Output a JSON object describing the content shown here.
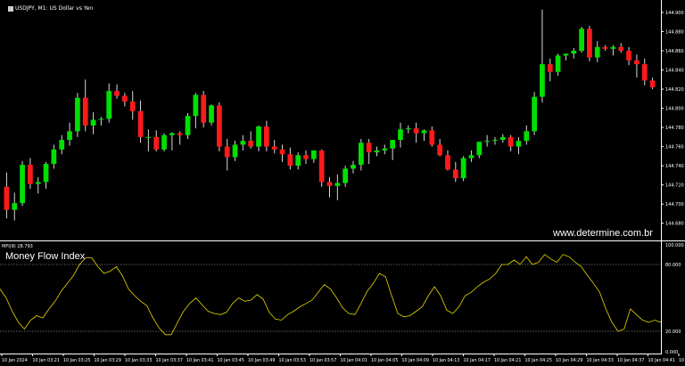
{
  "header": {
    "symbol_label": "USDJPY, M1:  US Dollar vs Yen"
  },
  "indicator": {
    "label": "MFI(9) 28.793",
    "title": "Money Flow Index"
  },
  "watermark": "www.determine.com.br",
  "colors": {
    "background": "#000000",
    "bull": "#00e000",
    "bear": "#ff1a1a",
    "wick": "#d8d8d8",
    "axis": "#ffffff",
    "mfi_line": "#e6d700",
    "level_line": "#bdbdbd"
  },
  "chart_data": [
    {
      "type": "candlestick",
      "title": "USDJPY, M1:  US Dollar vs Yen",
      "ylim": [
        144.663,
        144.913
      ],
      "y_ticks": [
        "144.900",
        "144.880",
        "144.860",
        "144.840",
        "144.820",
        "144.800",
        "144.780",
        "144.760",
        "144.740",
        "144.720",
        "144.700",
        "144.680"
      ],
      "x_tick_labels": [
        "10 Jan 2024",
        "10 Jan 03:21",
        "10 Jan 03:25",
        "10 Jan 03:29",
        "10 Jan 03:33",
        "10 Jan 03:37",
        "10 Jan 03:41",
        "10 Jan 03:45",
        "10 Jan 03:49",
        "10 Jan 03:53",
        "10 Jan 03:57",
        "10 Jan 04:01",
        "10 Jan 04:05",
        "10 Jan 04:09",
        "10 Jan 04:13",
        "10 Jan 04:17",
        "10 Jan 04:21",
        "10 Jan 04:25",
        "10 Jan 04:29",
        "10 Jan 04:33",
        "10 Jan 04:37",
        "10 Jan 04:41",
        "10 Jan 04:45"
      ],
      "candles": [
        {
          "o": 144.718,
          "h": 144.733,
          "l": 144.685,
          "c": 144.694
        },
        {
          "o": 144.694,
          "h": 144.712,
          "l": 144.683,
          "c": 144.701
        },
        {
          "o": 144.701,
          "h": 144.745,
          "l": 144.698,
          "c": 144.741
        },
        {
          "o": 144.741,
          "h": 144.748,
          "l": 144.716,
          "c": 144.721
        },
        {
          "o": 144.721,
          "h": 144.728,
          "l": 144.711,
          "c": 144.723
        },
        {
          "o": 144.723,
          "h": 144.744,
          "l": 144.716,
          "c": 144.742
        },
        {
          "o": 144.742,
          "h": 144.762,
          "l": 144.737,
          "c": 144.757
        },
        {
          "o": 144.757,
          "h": 144.772,
          "l": 144.752,
          "c": 144.767
        },
        {
          "o": 144.767,
          "h": 144.785,
          "l": 144.761,
          "c": 144.776
        },
        {
          "o": 144.776,
          "h": 144.816,
          "l": 144.77,
          "c": 144.811
        },
        {
          "o": 144.811,
          "h": 144.83,
          "l": 144.776,
          "c": 144.782
        },
        {
          "o": 144.782,
          "h": 144.796,
          "l": 144.773,
          "c": 144.788
        },
        {
          "o": 144.788,
          "h": 144.791,
          "l": 144.782,
          "c": 144.789
        },
        {
          "o": 144.789,
          "h": 144.826,
          "l": 144.785,
          "c": 144.818
        },
        {
          "o": 144.818,
          "h": 144.825,
          "l": 144.81,
          "c": 144.813
        },
        {
          "o": 144.813,
          "h": 144.816,
          "l": 144.802,
          "c": 144.807
        },
        {
          "o": 144.807,
          "h": 144.818,
          "l": 144.788,
          "c": 144.797
        },
        {
          "o": 144.797,
          "h": 144.808,
          "l": 144.764,
          "c": 144.77
        },
        {
          "o": 144.77,
          "h": 144.778,
          "l": 144.755,
          "c": 144.77
        },
        {
          "o": 144.77,
          "h": 144.777,
          "l": 144.755,
          "c": 144.757
        },
        {
          "o": 144.757,
          "h": 144.774,
          "l": 144.755,
          "c": 144.772
        },
        {
          "o": 144.772,
          "h": 144.775,
          "l": 144.756,
          "c": 144.774
        },
        {
          "o": 144.774,
          "h": 144.776,
          "l": 144.762,
          "c": 144.772
        },
        {
          "o": 144.772,
          "h": 144.795,
          "l": 144.768,
          "c": 144.792
        },
        {
          "o": 144.792,
          "h": 144.816,
          "l": 144.779,
          "c": 144.814
        },
        {
          "o": 144.814,
          "h": 144.818,
          "l": 144.78,
          "c": 144.785
        },
        {
          "o": 144.785,
          "h": 144.804,
          "l": 144.782,
          "c": 144.803
        },
        {
          "o": 144.803,
          "h": 144.806,
          "l": 144.755,
          "c": 144.76
        },
        {
          "o": 144.76,
          "h": 144.768,
          "l": 144.735,
          "c": 144.749
        },
        {
          "o": 144.749,
          "h": 144.766,
          "l": 144.745,
          "c": 144.762
        },
        {
          "o": 144.762,
          "h": 144.772,
          "l": 144.756,
          "c": 144.766
        },
        {
          "o": 144.766,
          "h": 144.776,
          "l": 144.758,
          "c": 144.76
        },
        {
          "o": 144.76,
          "h": 144.782,
          "l": 144.755,
          "c": 144.781
        },
        {
          "o": 144.781,
          "h": 144.787,
          "l": 144.755,
          "c": 144.76
        },
        {
          "o": 144.76,
          "h": 144.767,
          "l": 144.753,
          "c": 144.757
        },
        {
          "o": 144.757,
          "h": 144.762,
          "l": 144.744,
          "c": 144.752
        },
        {
          "o": 144.752,
          "h": 144.759,
          "l": 144.736,
          "c": 144.74
        },
        {
          "o": 144.74,
          "h": 144.754,
          "l": 144.736,
          "c": 144.751
        },
        {
          "o": 144.751,
          "h": 144.756,
          "l": 144.742,
          "c": 144.747
        },
        {
          "o": 144.747,
          "h": 144.755,
          "l": 144.743,
          "c": 144.756
        },
        {
          "o": 144.756,
          "h": 144.757,
          "l": 144.718,
          "c": 144.723
        },
        {
          "o": 144.723,
          "h": 144.728,
          "l": 144.707,
          "c": 144.719
        },
        {
          "o": 144.719,
          "h": 144.731,
          "l": 144.704,
          "c": 144.722
        },
        {
          "o": 144.722,
          "h": 144.74,
          "l": 144.718,
          "c": 144.737
        },
        {
          "o": 144.737,
          "h": 144.745,
          "l": 144.732,
          "c": 144.741
        },
        {
          "o": 144.741,
          "h": 144.768,
          "l": 144.735,
          "c": 144.764
        },
        {
          "o": 144.764,
          "h": 144.768,
          "l": 144.742,
          "c": 144.754
        },
        {
          "o": 144.754,
          "h": 144.76,
          "l": 144.75,
          "c": 144.756
        },
        {
          "o": 144.756,
          "h": 144.762,
          "l": 144.752,
          "c": 144.758
        },
        {
          "o": 144.758,
          "h": 144.767,
          "l": 144.746,
          "c": 144.767
        },
        {
          "o": 144.767,
          "h": 144.785,
          "l": 144.759,
          "c": 144.778
        },
        {
          "o": 144.778,
          "h": 144.782,
          "l": 144.774,
          "c": 144.779
        },
        {
          "o": 144.779,
          "h": 144.785,
          "l": 144.764,
          "c": 144.774
        },
        {
          "o": 144.774,
          "h": 144.778,
          "l": 144.766,
          "c": 144.777
        },
        {
          "o": 144.777,
          "h": 144.781,
          "l": 144.76,
          "c": 144.762
        },
        {
          "o": 144.762,
          "h": 144.768,
          "l": 144.75,
          "c": 144.751
        },
        {
          "o": 144.751,
          "h": 144.756,
          "l": 144.735,
          "c": 144.736
        },
        {
          "o": 144.736,
          "h": 144.744,
          "l": 144.723,
          "c": 144.727
        },
        {
          "o": 144.727,
          "h": 144.75,
          "l": 144.724,
          "c": 144.748
        },
        {
          "o": 144.748,
          "h": 144.756,
          "l": 144.744,
          "c": 144.751
        },
        {
          "o": 144.751,
          "h": 144.761,
          "l": 144.748,
          "c": 144.765
        },
        {
          "o": 144.765,
          "h": 144.772,
          "l": 144.76,
          "c": 144.766
        },
        {
          "o": 144.766,
          "h": 144.77,
          "l": 144.762,
          "c": 144.767
        },
        {
          "o": 144.767,
          "h": 144.773,
          "l": 144.764,
          "c": 144.77
        },
        {
          "o": 144.77,
          "h": 144.772,
          "l": 144.755,
          "c": 144.76
        },
        {
          "o": 144.76,
          "h": 144.77,
          "l": 144.752,
          "c": 144.766
        },
        {
          "o": 144.766,
          "h": 144.782,
          "l": 144.762,
          "c": 144.776
        },
        {
          "o": 144.776,
          "h": 144.817,
          "l": 144.772,
          "c": 144.812
        },
        {
          "o": 144.812,
          "h": 144.903,
          "l": 144.806,
          "c": 144.846
        },
        {
          "o": 144.846,
          "h": 144.852,
          "l": 144.828,
          "c": 144.838
        },
        {
          "o": 144.838,
          "h": 144.857,
          "l": 144.834,
          "c": 144.855
        },
        {
          "o": 144.855,
          "h": 144.857,
          "l": 144.85,
          "c": 144.857
        },
        {
          "o": 144.857,
          "h": 144.863,
          "l": 144.852,
          "c": 144.86
        },
        {
          "o": 144.86,
          "h": 144.885,
          "l": 144.858,
          "c": 144.883
        },
        {
          "o": 144.883,
          "h": 144.886,
          "l": 144.849,
          "c": 144.853
        },
        {
          "o": 144.853,
          "h": 144.87,
          "l": 144.848,
          "c": 144.864
        },
        {
          "o": 144.864,
          "h": 144.866,
          "l": 144.86,
          "c": 144.862
        },
        {
          "o": 144.862,
          "h": 144.866,
          "l": 144.855,
          "c": 144.864
        },
        {
          "o": 144.864,
          "h": 144.868,
          "l": 144.858,
          "c": 144.86
        },
        {
          "o": 144.86,
          "h": 144.864,
          "l": 144.845,
          "c": 144.85
        },
        {
          "o": 144.85,
          "h": 144.856,
          "l": 144.832,
          "c": 144.846
        },
        {
          "o": 144.846,
          "h": 144.852,
          "l": 144.824,
          "c": 144.829
        },
        {
          "o": 144.829,
          "h": 144.832,
          "l": 144.82,
          "c": 144.822
        }
      ]
    },
    {
      "type": "line",
      "title": "Money Flow Index",
      "ylim": [
        0,
        100
      ],
      "y_ticks": [
        "100.000",
        "80.000",
        "20.000",
        "0.000"
      ],
      "levels": [
        80,
        20
      ],
      "series": [
        {
          "name": "MFI(9)",
          "values": [
            58,
            50,
            38,
            28,
            22,
            30,
            34,
            32,
            40,
            47,
            56,
            63,
            70,
            80,
            86,
            86,
            78,
            72,
            74,
            78,
            70,
            58,
            52,
            47,
            43,
            32,
            23,
            17,
            17,
            28,
            38,
            45,
            50,
            44,
            38,
            36,
            35,
            37,
            45,
            50,
            47,
            48,
            53,
            49,
            37,
            31,
            30,
            35,
            38,
            42,
            45,
            48,
            55,
            62,
            58,
            50,
            41,
            36,
            35,
            45,
            56,
            63,
            72,
            69,
            52,
            36,
            33,
            34,
            38,
            42,
            52,
            60,
            52,
            39,
            36,
            42,
            52,
            55,
            60,
            64,
            67,
            72,
            80,
            80,
            84,
            80,
            87,
            80,
            82,
            89,
            85,
            82,
            89,
            87,
            82,
            78,
            70,
            63,
            55,
            40,
            28,
            20,
            22,
            40,
            35,
            30,
            28,
            30,
            28
          ]
        }
      ]
    }
  ]
}
